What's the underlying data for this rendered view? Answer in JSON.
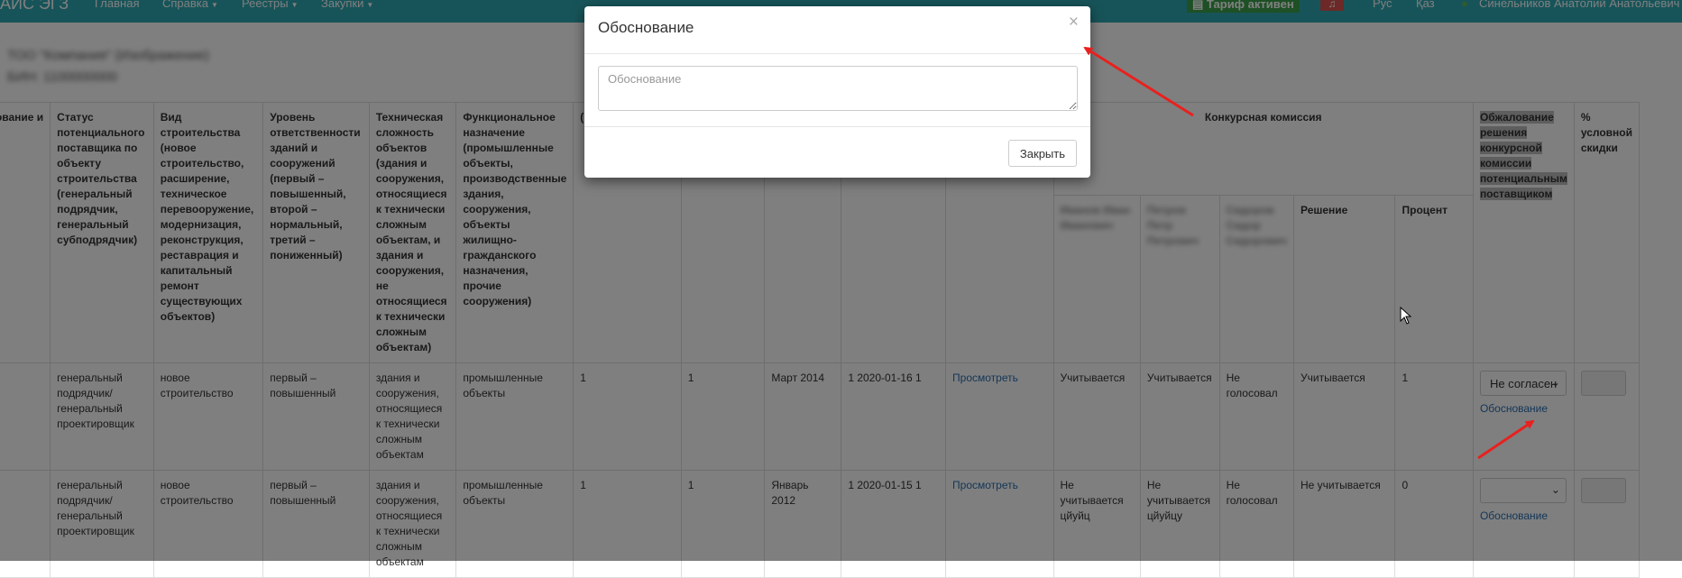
{
  "navbar": {
    "brand": "АИС ЭГЗ",
    "items": [
      {
        "label": "Главная",
        "has_caret": false
      },
      {
        "label": "Справка",
        "has_caret": true
      },
      {
        "label": "Реестры",
        "has_caret": true
      },
      {
        "label": "Закупки",
        "has_caret": true
      }
    ],
    "tariff_badge": "Тариф активен",
    "lang_ru": "Рус",
    "lang_kz": "Қаз",
    "user_name": "Синельников Анатолий Анатольевич",
    "colors": {
      "bar": "#2ea8b3",
      "tariff": "#3aa14a",
      "bell": "#d9534f"
    }
  },
  "page": {
    "company_name": "ТОО \"Компания\" (Изображение)",
    "bin_line": "БИН: 1100000000"
  },
  "table": {
    "headers": [
      "ование\nи",
      "Статус потенциального поставщика по объекту строительства (генеральный подрядчик, генеральный субподрядчик)",
      "Вид строительства (новое строительство, расширение, техническое перевооружение, модернизация, реконструкция, реставрация и капитальный ремонт существующих объектов)",
      "Уровень ответственности зданий и сооружений (первый – повышенный, второй – нормальный, третий – пониженный)",
      "Техническая сложность объектов (здания и сооружения, относящиеся к технически сложным объектам, и здания и сооружения, не относящиеся к технически сложным объектам)",
      "Функциональное назначение (промышленные объекты, производственные здания, сооружения, объекты жилищно-гражданского назначения, прочие сооружения)"
    ],
    "partial_header_fragment": "(месяц)",
    "commission_header": "Конкурсная комиссия",
    "commission_members": [
      "Иванов Иван Иванович",
      "Петров Петр Петрович",
      "Сидоров Сидор Сидорович"
    ],
    "decision_header": "Решение",
    "percent_header": "Процент",
    "appeal_header": "Обжалование решения конкурсной комиссии потенциальным поставщиком",
    "discount_header": "% условной скидки",
    "rows": [
      {
        "status": "генеральный подрядчик/ генеральный проектировщик",
        "build_type": "новое строительство",
        "level": "первый – повышенный",
        "complexity": "здания и сооружения, относящиеся к технически сложным объектам",
        "purpose": "промышленные объекты",
        "c1": "1",
        "c2": "1",
        "date": "Март 2014",
        "num": "1 2020-01-16 1",
        "view": "Просмотреть",
        "v1": "Учитывается",
        "v2": "Учитывается",
        "v3": "Не голосовал",
        "decision": "Учитывается",
        "percent": "1",
        "appeal_select": "Не согласен",
        "appeal_link": "Обоснование"
      },
      {
        "status": "генеральный подрядчик/ генеральный проектировщик",
        "build_type": "новое строительство",
        "level": "первый – повышенный",
        "complexity": "здания и сооружения, относящиеся к технически сложным объектам",
        "purpose": "промышленные объекты",
        "c1": "1",
        "c2": "1",
        "date": "Январь 2012",
        "num": "1 2020-01-15 1",
        "view": "Просмотреть",
        "v1": "Не учитывается цйуйц",
        "v2": "Не учитывается цйуйцу",
        "v3": "Не голосовал",
        "decision": "Не учитывается",
        "percent": "0",
        "appeal_select": "",
        "appeal_link": "Обоснование"
      }
    ]
  },
  "modal": {
    "title": "Обоснование",
    "close_symbol": "×",
    "textarea_placeholder": "Обоснование",
    "close_button": "Закрыть"
  },
  "annotation_color": "#e8211f"
}
